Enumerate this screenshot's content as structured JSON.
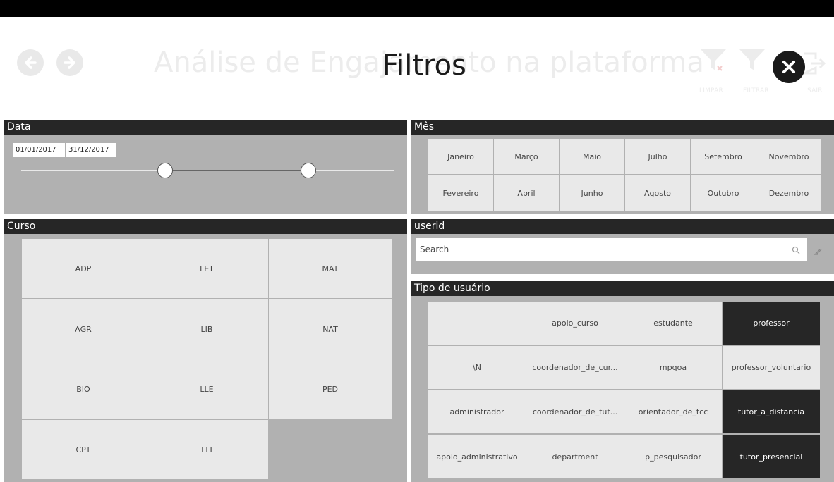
{
  "header": {
    "bg_title": "Análise de Engajamento na plataforma",
    "overlay_title": "Filtros",
    "labels": {
      "limpar": "LIMPAR",
      "filtrar": "FILTRAR",
      "sair": "SAIR"
    },
    "icons": {
      "back": "back-arrow-icon",
      "forward": "forward-arrow-icon",
      "clear": "clear-filter-icon",
      "filter": "filter-icon",
      "exit": "exit-icon",
      "close": "close-icon"
    }
  },
  "data_panel": {
    "title": "Data",
    "start_date": "01/01/2017",
    "end_date": "31/12/2017"
  },
  "mes_panel": {
    "title": "Mês",
    "row1": [
      "Janeiro",
      "Março",
      "Maio",
      "Julho",
      "Setembro",
      "Novembro"
    ],
    "row2": [
      "Fevereiro",
      "Abril",
      "Junho",
      "Agosto",
      "Outubro",
      "Dezembro"
    ]
  },
  "curso_panel": {
    "title": "Curso",
    "items": [
      "ADP",
      "LET",
      "MAT",
      "AGR",
      "LIB",
      "NAT",
      "BIO",
      "LLE",
      "PED",
      "CPT",
      "LLI"
    ]
  },
  "userid_panel": {
    "title": "userid",
    "search_placeholder": "Search"
  },
  "tipo_panel": {
    "title": "Tipo de usuário",
    "items": [
      {
        "label": "",
        "selected": false
      },
      {
        "label": "apoio_curso",
        "selected": false
      },
      {
        "label": "estudante",
        "selected": false
      },
      {
        "label": "professor",
        "selected": true
      },
      {
        "label": "\\N",
        "selected": false
      },
      {
        "label": "coordenador_de_cur...",
        "selected": false
      },
      {
        "label": "mpqoa",
        "selected": false
      },
      {
        "label": "professor_voluntario",
        "selected": false
      },
      {
        "label": "administrador",
        "selected": false
      },
      {
        "label": "coordenador_de_tut...",
        "selected": false
      },
      {
        "label": "orientador_de_tcc",
        "selected": false
      },
      {
        "label": "tutor_a_distancia",
        "selected": true
      },
      {
        "label": "apoio_administrativo",
        "selected": false
      },
      {
        "label": "department",
        "selected": false
      },
      {
        "label": "p_pesquisador",
        "selected": false
      },
      {
        "label": "tutor_presencial",
        "selected": true
      }
    ]
  },
  "colors": {
    "panel_bg": "#b1b1b1",
    "header_bar": "#262626",
    "tile": "#e9e9e9",
    "selected": "#262626"
  }
}
